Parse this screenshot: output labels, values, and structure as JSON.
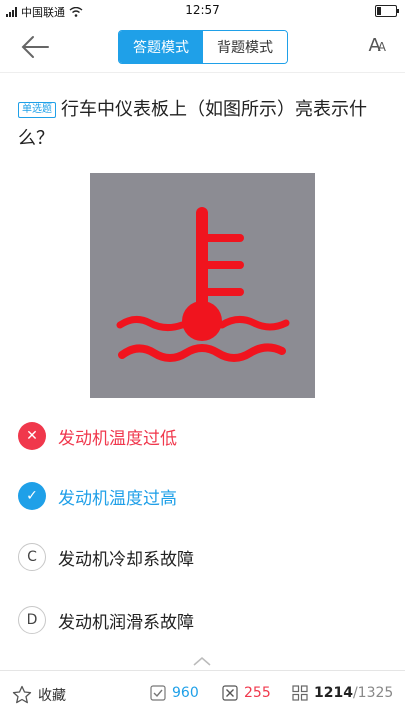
{
  "status_bar": {
    "carrier": "中国联通",
    "time": "12:57",
    "battery_level": 0.2
  },
  "nav": {
    "modes": [
      {
        "label": "答题模式",
        "active": true
      },
      {
        "label": "背题模式",
        "active": false
      }
    ],
    "font_button": "A"
  },
  "question": {
    "type_badge": "单选题",
    "text": "行车中仪表板上（如图所示）亮表示什么？",
    "image_icon": "engine-coolant-temperature-warning-icon",
    "image_icon_color": "#f0141e",
    "image_background": "#8c8c93"
  },
  "options": [
    {
      "marker": "✕",
      "text": "发动机温度过低",
      "state": "wrong"
    },
    {
      "marker": "✓",
      "text": "发动机温度过高",
      "state": "right"
    },
    {
      "marker": "C",
      "text": "发动机冷却系故障",
      "state": "plain"
    },
    {
      "marker": "D",
      "text": "发动机润滑系故障",
      "state": "plain"
    }
  ],
  "bottom_bar": {
    "favorite_label": "收藏",
    "correct_count": "960",
    "wrong_count": "255",
    "current_index": "1214",
    "total": "/1325"
  },
  "colors": {
    "accent": "#1fa0e8",
    "wrong": "#f0384c"
  }
}
